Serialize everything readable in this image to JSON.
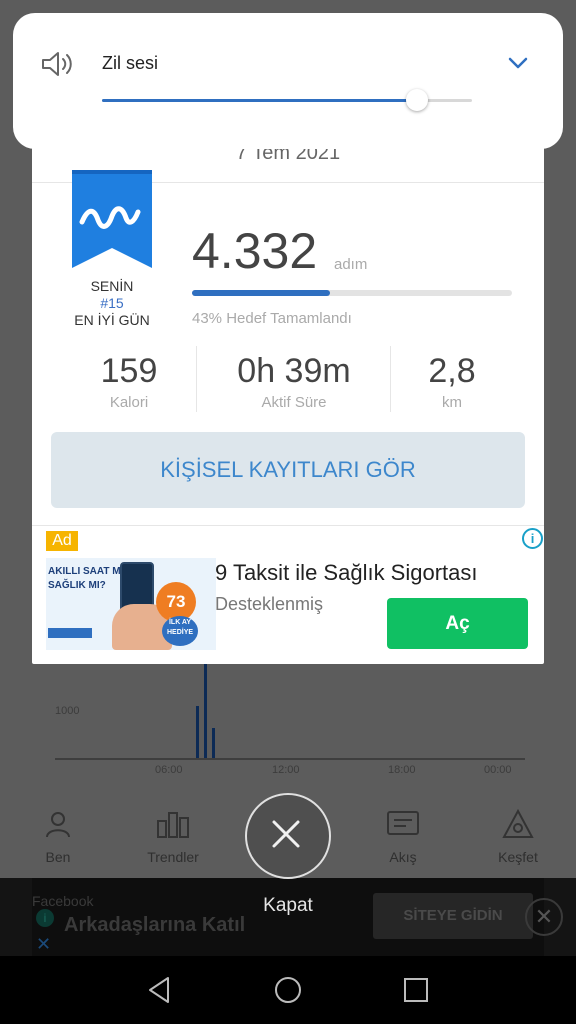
{
  "volume": {
    "label": "Zil sesi",
    "level": 0.85,
    "speaker_icon": "speaker-icon",
    "expand_icon": "chevron-down-icon"
  },
  "card": {
    "date": "7 Tem 2021",
    "best_day": {
      "line1": "SENİN",
      "rank": "#15",
      "line3": "EN İYİ GÜN"
    },
    "steps": {
      "value": "4.332",
      "unit": "adım",
      "goal_fraction": 0.43,
      "goal_text": "43% Hedef Tamamlandı"
    },
    "stats": [
      {
        "value": "159",
        "label": "Kalori"
      },
      {
        "value": "0h 39m",
        "label": "Aktif Süre"
      },
      {
        "value": "2,8",
        "label": "km"
      }
    ],
    "records_button": "KİŞİSEL KAYITLARI GÖR",
    "ad": {
      "badge": "Ad",
      "title": "9 Taksit ile Sağlık Sigortası",
      "sponsored": "Desteklenmiş",
      "button": "Aç",
      "image_text": {
        "line1": "AKILLI SAAT MI?",
        "line2": "SAĞLIK MI?",
        "price": "73",
        "badge": "İLK AY HEDİYE"
      }
    }
  },
  "close": {
    "label": "Kapat"
  },
  "background": {
    "nav": [
      "Ben",
      "Trendler",
      "Akış",
      "Keşfet"
    ],
    "ticks": [
      "06:00",
      "12:00",
      "18:00",
      "00:00"
    ],
    "y_tick": "1000",
    "banner": {
      "source": "Facebook",
      "title": "Arkadaşlarına Katıl",
      "button": "SİTEYE GİDİN"
    }
  },
  "colors": {
    "accent": "#2f6fc0",
    "ad_button": "#10c063",
    "records_text": "#3d87cc",
    "ribbon": "#1f7fe0"
  }
}
